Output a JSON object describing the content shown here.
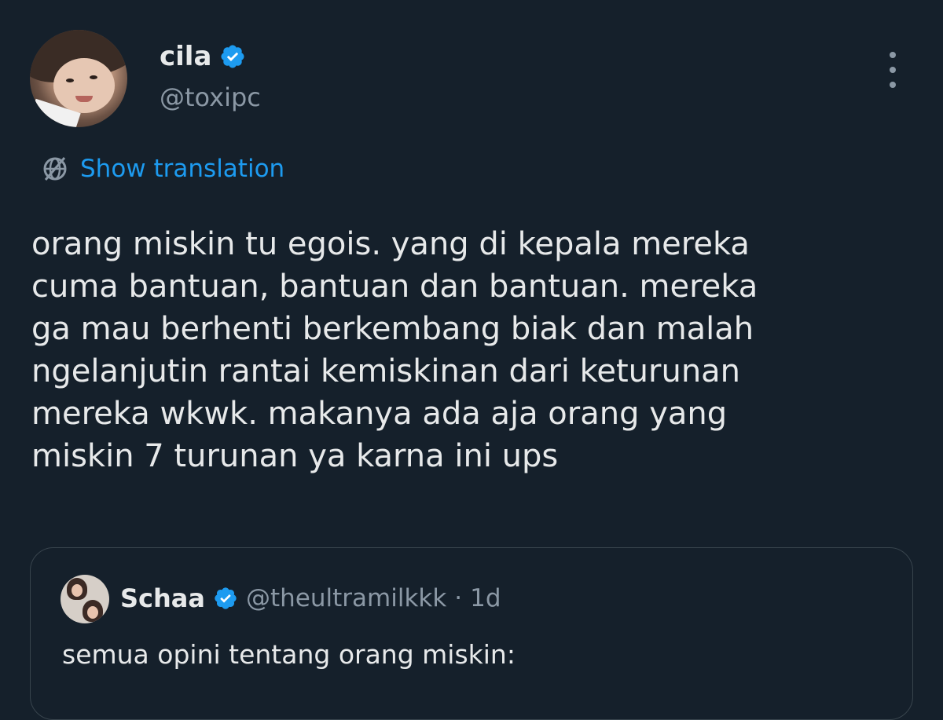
{
  "author": {
    "display_name": "cila",
    "handle": "@toxipc",
    "verified": true
  },
  "actions": {
    "more_icon": "more-vertical-icon",
    "show_translation": "Show translation",
    "translation_icon": "globe-icon"
  },
  "tweet": {
    "lines": [
      "orang miskin tu egois. yang di kepala mereka",
      "cuma bantuan, bantuan dan bantuan. mereka",
      "ga mau berhenti berkembang biak dan malah",
      "ngelanjutin rantai kemiskinan dari keturunan",
      "mereka wkwk. makanya ada aja orang yang",
      "miskin 7 turunan ya karna ini ups"
    ]
  },
  "quote": {
    "display_name": "Schaa",
    "handle": "@theultramilkkk",
    "separator": "·",
    "time": "1d",
    "verified": true,
    "text": "semua opini tentang orang miskin:"
  },
  "colors": {
    "background": "#15202b",
    "text": "#e7e9ea",
    "secondary": "#8b98a5",
    "accent": "#1d9bf0",
    "border": "#38444d"
  }
}
